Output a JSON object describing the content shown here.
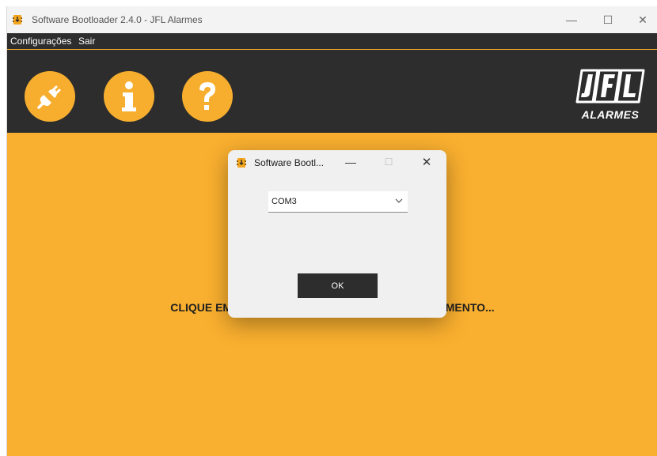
{
  "window": {
    "title": "Software Bootloader 2.4.0 - JFL Alarmes",
    "controls": {
      "minimize": "—",
      "maximize": "☐",
      "close": "✕"
    }
  },
  "menu": {
    "items": [
      "Configurações",
      "Sair"
    ]
  },
  "toolbar": {
    "buttons": [
      {
        "icon": "plug-icon"
      },
      {
        "icon": "info-icon"
      },
      {
        "icon": "help-icon"
      }
    ],
    "logo": {
      "name": "JFL",
      "text": "ALARMES"
    }
  },
  "main": {
    "status_text": "CLIQUE EM CONECTAR PARA INICIAR O CARREGAMENTO...",
    "background": "#f9af2f"
  },
  "dialog": {
    "title": "Software Bootl...",
    "controls": {
      "minimize": "—",
      "maximize": "☐",
      "close": "✕"
    },
    "port_select": {
      "value": "COM3"
    },
    "ok_label": "OK"
  },
  "colors": {
    "accent": "#f7ae2f",
    "dark": "#2d2d2d"
  }
}
